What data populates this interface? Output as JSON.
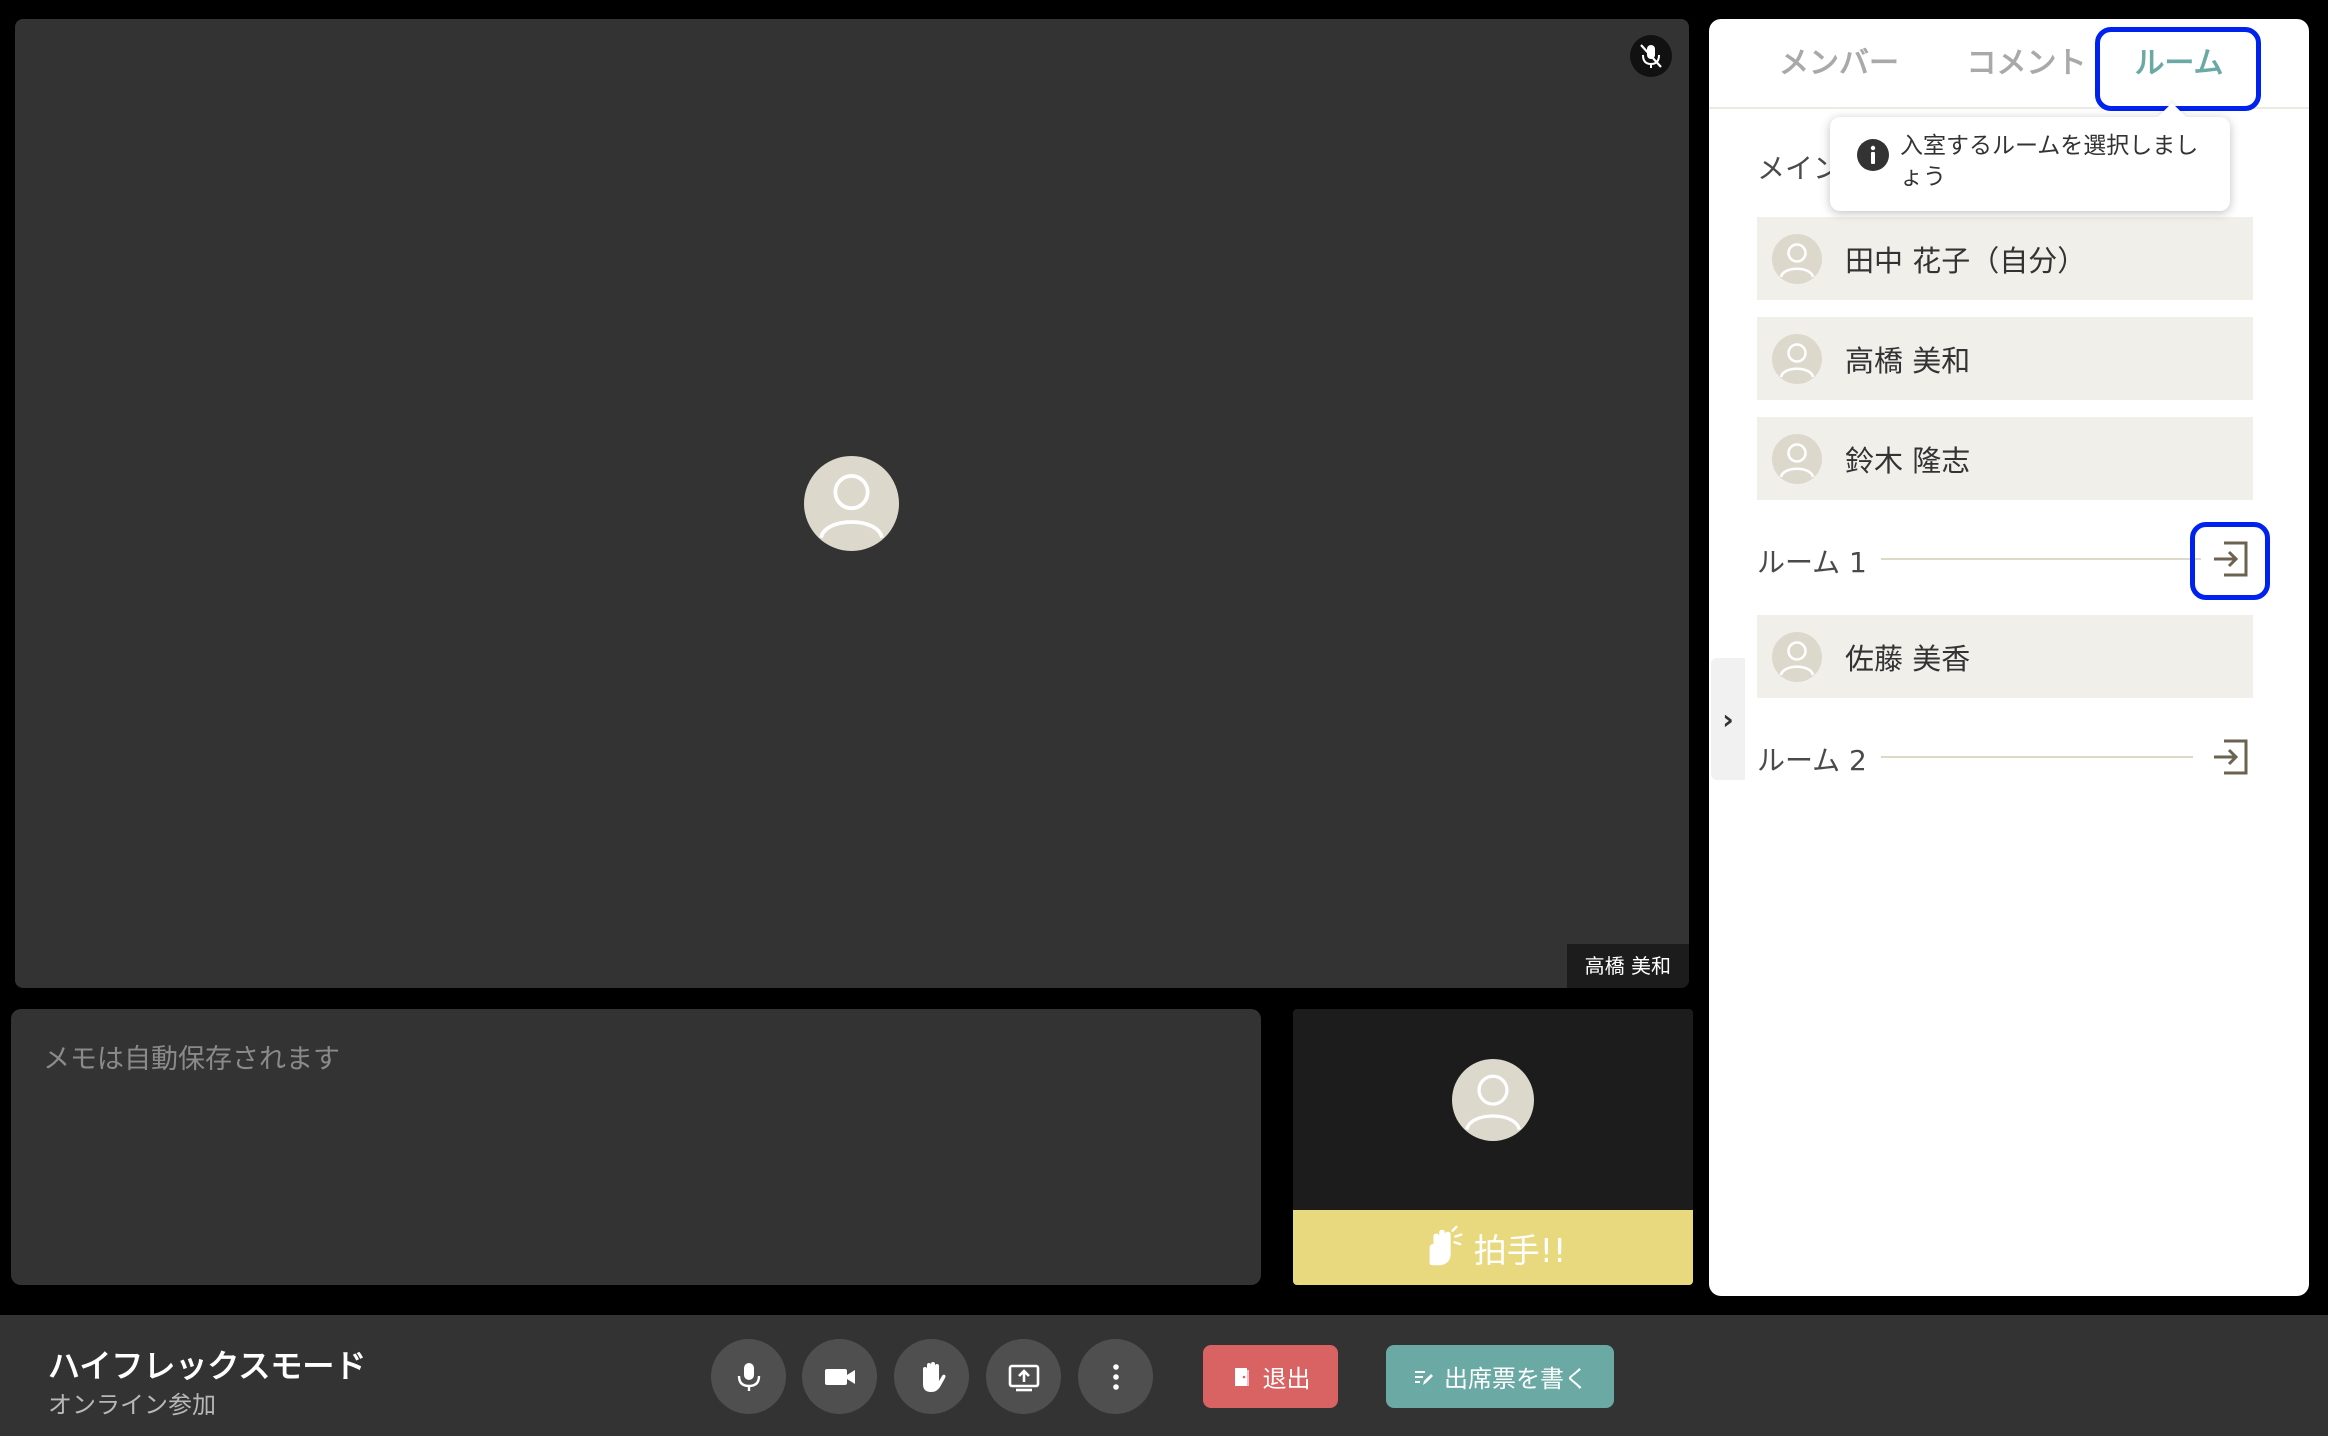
{
  "main_video": {
    "participant_name": "高橋 美和",
    "mic_status_icon": "mic-off-icon"
  },
  "memo": {
    "placeholder": "メモは自動保存されます",
    "value": ""
  },
  "self_view": {
    "clap_label": "拍手!!",
    "clap_icon": "clapping-hands-icon"
  },
  "side_panel": {
    "tabs": [
      {
        "label": "メンバー",
        "active": false
      },
      {
        "label": "コメント",
        "active": false
      },
      {
        "label": "ルーム",
        "active": true
      }
    ],
    "tooltip": {
      "text": "入室するルームを選択しましょう",
      "icon": "info-icon"
    },
    "main_room": {
      "label": "メイン",
      "members": [
        "田中 花子（自分）",
        "高橋 美和",
        "鈴木 隆志"
      ]
    },
    "rooms": [
      {
        "label": "ルーム 1",
        "members": [
          "佐藤 美香"
        ],
        "enter_icon": "enter-room-icon"
      },
      {
        "label": "ルーム 2",
        "members": [],
        "enter_icon": "enter-room-icon"
      }
    ],
    "collapse_glyph": "›"
  },
  "bottom_bar": {
    "mode_title": "ハイフレックスモード",
    "mode_subtitle": "オンライン参加",
    "controls": [
      "mic-icon",
      "camera-icon",
      "raise-hand-icon",
      "screen-share-icon",
      "more-vertical-icon"
    ],
    "leave_label": "退出",
    "attendance_label": "出席票を書く"
  },
  "colors": {
    "accent_teal": "#6aa9a4",
    "leave_red": "#d96262",
    "clap_yellow": "#e8d87e",
    "highlight_blue": "#0022ee"
  }
}
